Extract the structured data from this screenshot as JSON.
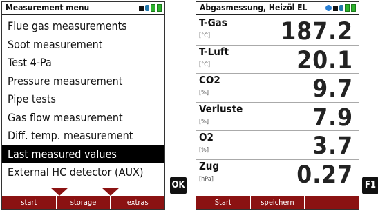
{
  "left": {
    "title": "Measurement menu",
    "menu_items": [
      {
        "label": "Flue gas measurements"
      },
      {
        "label": "Soot measurement"
      },
      {
        "label": "Test 4-Pa"
      },
      {
        "label": "Pressure measurement"
      },
      {
        "label": "Pipe tests"
      },
      {
        "label": "Gas flow measurement"
      },
      {
        "label": "Diff. temp. measurement"
      },
      {
        "label": "Last measured values"
      },
      {
        "label": "External HC detector (AUX)"
      }
    ],
    "selected_index": 7,
    "softkeys": [
      "start",
      "storage",
      "extras"
    ]
  },
  "right": {
    "title": "Abgasmessung, Heizöl EL",
    "rows": [
      {
        "label": "T-Gas",
        "unit": "[°C]",
        "value": "187.2"
      },
      {
        "label": "T-Luft",
        "unit": "[°C]",
        "value": "20.1"
      },
      {
        "label": "CO2",
        "unit": "[%]",
        "value": "9.7"
      },
      {
        "label": "Verluste",
        "unit": "[%]",
        "value": "7.9"
      },
      {
        "label": "O2",
        "unit": "[%]",
        "value": "3.7"
      },
      {
        "label": "Zug",
        "unit": "[hPa]",
        "value": "0.27"
      }
    ],
    "softkeys": [
      "Start",
      "speichern",
      ""
    ]
  },
  "keys": {
    "ok": "OK",
    "f1": "F1"
  },
  "colors": {
    "softkey_bar": "#8b1212",
    "battery": "#2db22d",
    "info": "#2a7fd4",
    "selection": "#000000"
  }
}
